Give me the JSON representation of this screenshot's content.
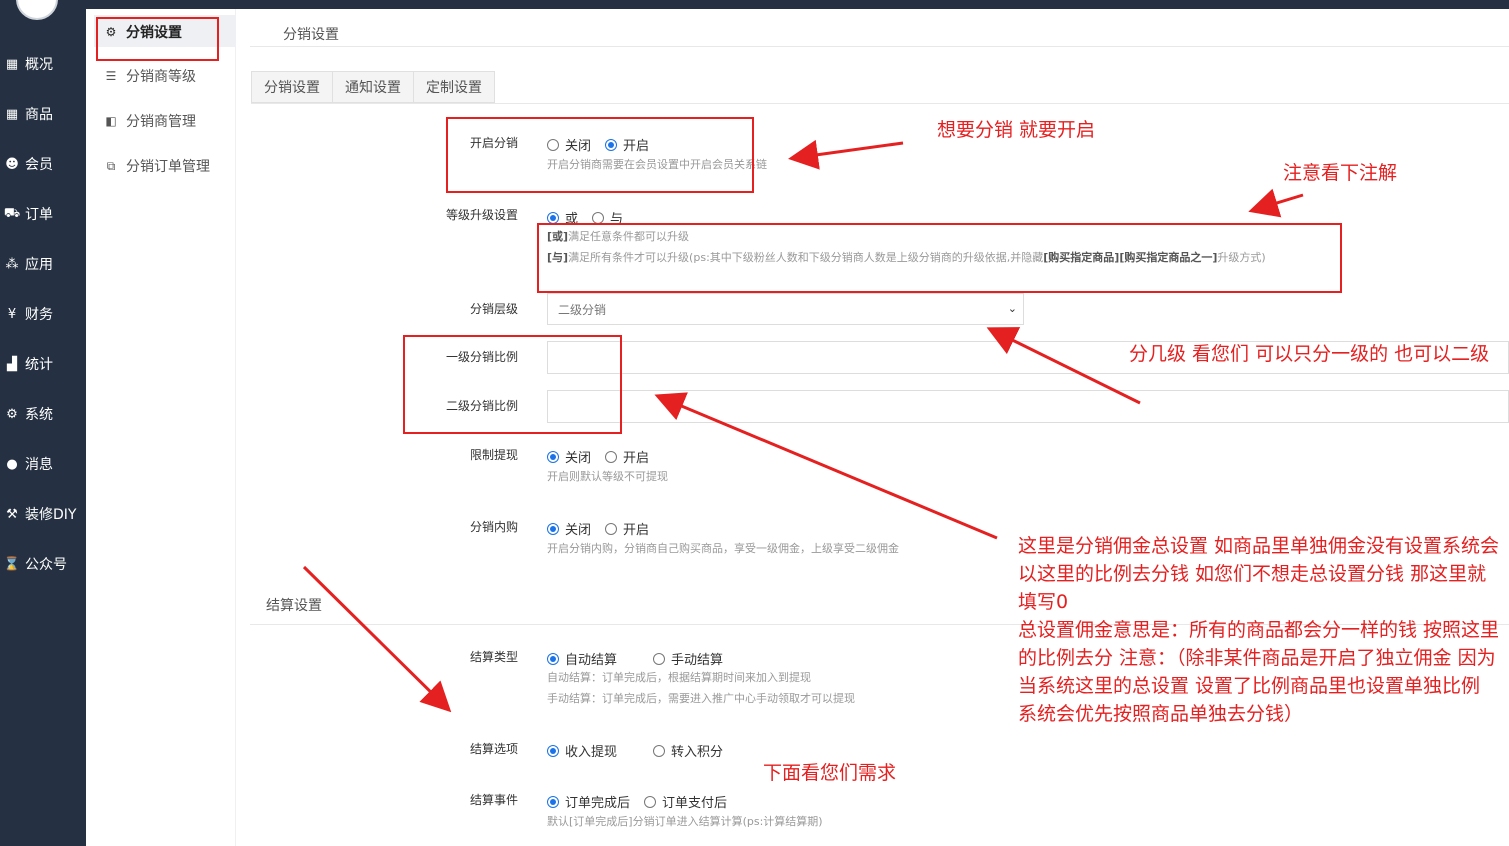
{
  "nav": {
    "items": [
      {
        "icon": "calendar-icon",
        "label": "概况"
      },
      {
        "icon": "calendar-icon",
        "label": "商品"
      },
      {
        "icon": "users-icon",
        "label": "会员"
      },
      {
        "icon": "cart-icon",
        "label": "订单"
      },
      {
        "icon": "cubes-icon",
        "label": "应用"
      },
      {
        "icon": "yen-icon",
        "label": "财务"
      },
      {
        "icon": "bar-chart-icon",
        "label": "统计"
      },
      {
        "icon": "cogs-icon",
        "label": "系统"
      },
      {
        "icon": "chat-icon",
        "label": "消息"
      },
      {
        "icon": "gavel-icon",
        "label": "装修DIY"
      },
      {
        "icon": "hourglass-icon",
        "label": "公众号"
      }
    ]
  },
  "submenu": {
    "items": [
      {
        "icon": "gear-icon",
        "label": "分销设置"
      },
      {
        "icon": "sliders-icon",
        "label": "分销商等级"
      },
      {
        "icon": "share-icon",
        "label": "分销商管理"
      },
      {
        "icon": "copy-icon",
        "label": "分销订单管理"
      }
    ]
  },
  "page": {
    "title": "分销设置",
    "tabs": [
      "分销设置",
      "通知设置",
      "定制设置"
    ]
  },
  "form": {
    "enable": {
      "label": "开启分销",
      "options": [
        "关闭",
        "开启"
      ],
      "selected": 1,
      "help": "开启分销商需要在会员设置中开启会员关系链"
    },
    "upgrade": {
      "label": "等级升级设置",
      "options": [
        "或",
        "与"
      ],
      "selected": 0,
      "help_or_tag": "[或]",
      "help_or": "满足任意条件都可以升级",
      "help_and_tag": "[与]",
      "help_and_pre": "满足所有条件才可以升级(ps:其中下级粉丝人数和下级分销商人数是上级分销商的升级依据,并隐藏",
      "help_and_bold": "[购买指定商品][购买指定商品之一]",
      "help_and_post": "升级方式)"
    },
    "levels": {
      "label": "分销层级",
      "value": "二级分销"
    },
    "ratio1": {
      "label": "一级分销比例"
    },
    "ratio2": {
      "label": "二级分销比例"
    },
    "withdraw": {
      "label": "限制提现",
      "options": [
        "关闭",
        "开启"
      ],
      "selected": 0,
      "help": "开启则默认等级不可提现"
    },
    "inbuy": {
      "label": "分销内购",
      "options": [
        "关闭",
        "开启"
      ],
      "selected": 0,
      "help": "开启分销内购，分销商自己购买商品，享受一级佣金，上级享受二级佣金"
    }
  },
  "settle": {
    "title": "结算设置",
    "type": {
      "label": "结算类型",
      "options": [
        "自动结算",
        "手动结算"
      ],
      "selected": 0,
      "help1": "自动结算：订单完成后，根据结算期时间来加入到提现",
      "help2": "手动结算：订单完成后，需要进入推广中心手动领取才可以提现"
    },
    "option": {
      "label": "结算选项",
      "options": [
        "收入提现",
        "转入积分"
      ],
      "selected": 0
    },
    "event": {
      "label": "结算事件",
      "options": [
        "订单完成后",
        "订单支付后"
      ],
      "selected": 0,
      "help": "默认[订单完成后]分销订单进入结算计算(ps:计算结算期)"
    }
  },
  "annotations": {
    "enable_note": "想要分销 就要开启",
    "upgrade_note": "注意看下注解",
    "levels_note": "分几级   看您们 可以只分一级的 也可以二级",
    "ratio_note": "这里是分销佣金总设置  如商品里单独佣金没有设置系统会以这里的比例去分钱  如您们不想走总设置分钱 那这里就填写0\n总设置佣金意思是：所有的商品都会分一样的钱 按照这里的比例去分      注意：（除非某件商品是开启了独立佣金  因为当系统这里的总设置  设置了比例商品里也设置单独比例  系统会优先按照商品单独去分钱）",
    "settle_note": "下面看您们需求",
    "color": "#e52020"
  }
}
